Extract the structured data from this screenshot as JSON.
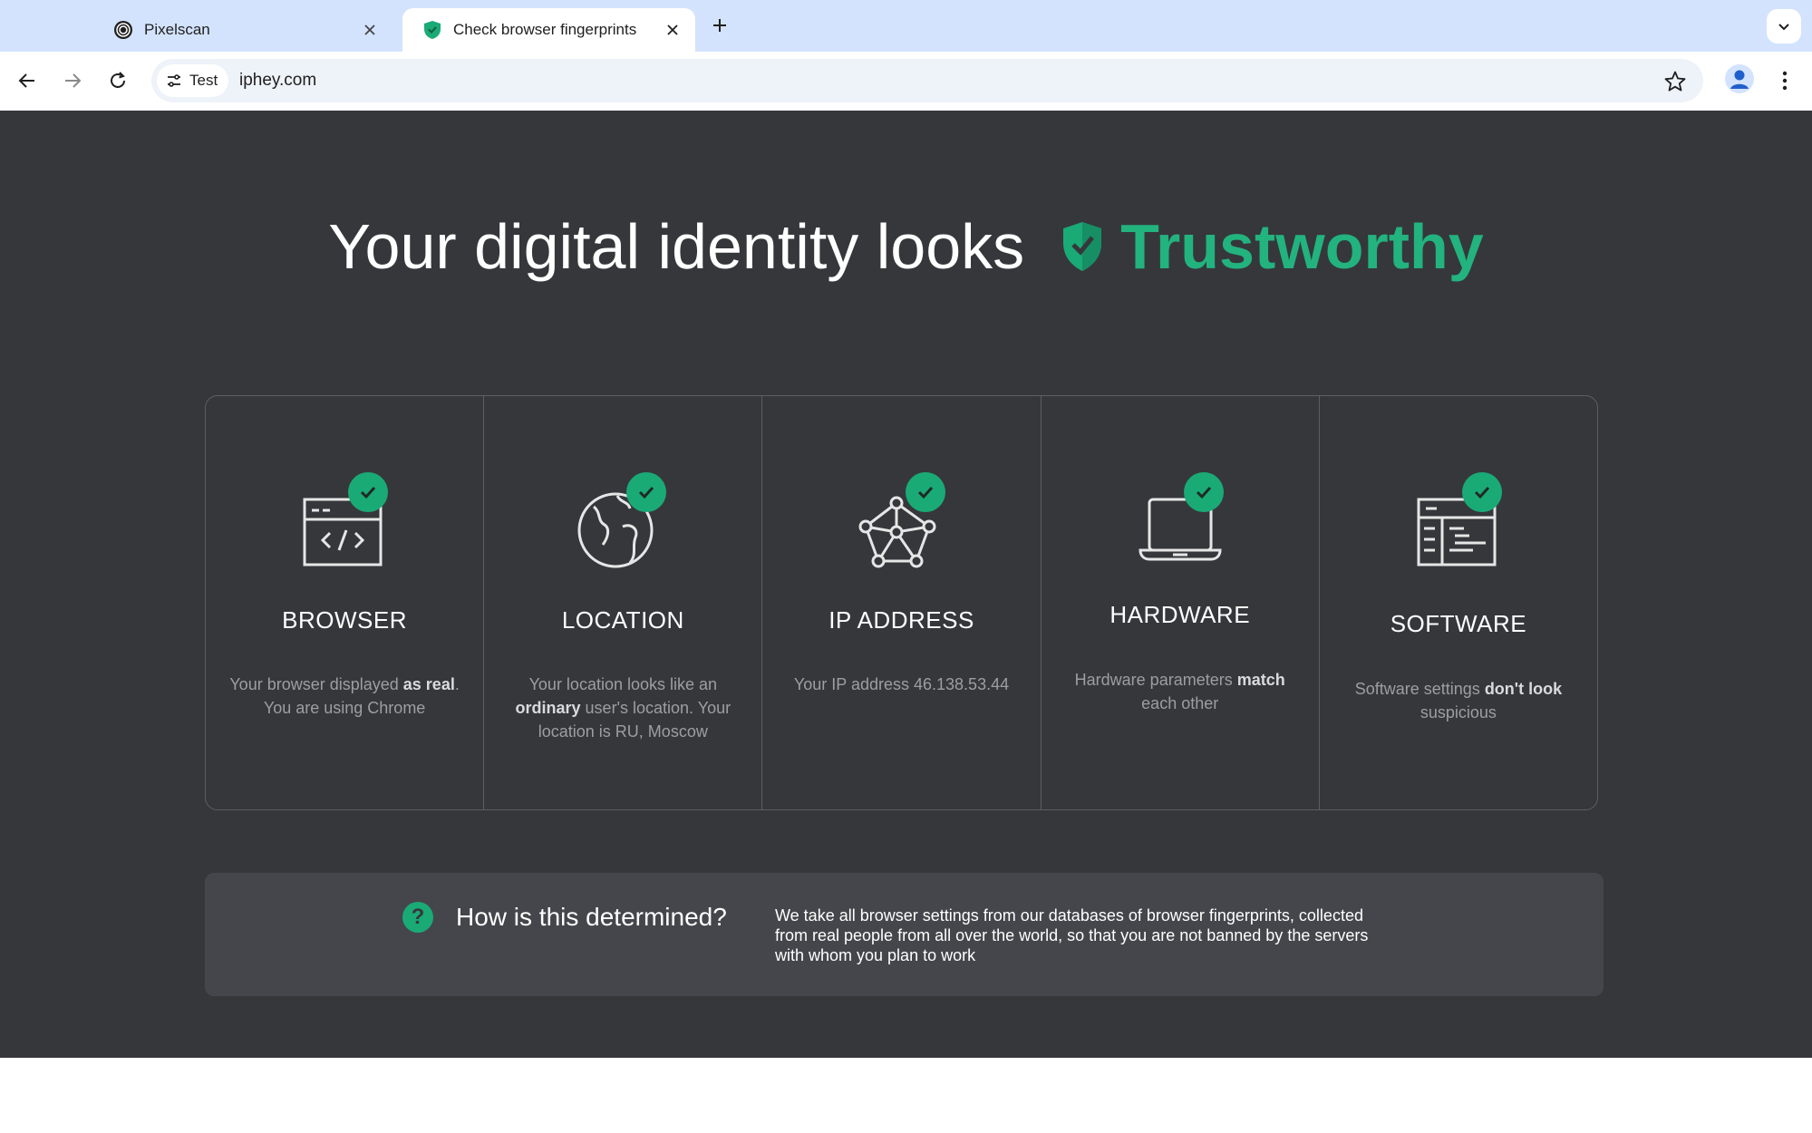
{
  "browser": {
    "tabs": [
      {
        "title": "Pixelscan",
        "active": false
      },
      {
        "title": "Check browser fingerprints",
        "active": true
      }
    ],
    "site_chip_label": "Test",
    "url": "iphey.com"
  },
  "page": {
    "headline": {
      "prefix": "Your digital identity looks",
      "status": "Trustworthy",
      "status_color": "#22b37f"
    },
    "cards": [
      {
        "label": "BROWSER",
        "icon": "browser-code-icon",
        "desc_parts": [
          [
            "Your browser displayed ",
            false
          ],
          [
            "as real",
            true
          ],
          [
            ". You are using Chrome",
            false
          ]
        ]
      },
      {
        "label": "LOCATION",
        "icon": "globe-icon",
        "desc_parts": [
          [
            "Your location looks like an ",
            false
          ],
          [
            "ordinary",
            true
          ],
          [
            " user's location. Your location is RU, Moscow",
            false
          ]
        ]
      },
      {
        "label": "IP ADDRESS",
        "icon": "network-icon",
        "desc_parts": [
          [
            "Your IP address 46.138.53.44",
            false
          ]
        ]
      },
      {
        "label": "HARDWARE",
        "icon": "laptop-icon",
        "desc_parts": [
          [
            "Hardware parameters ",
            false
          ],
          [
            "match",
            true
          ],
          [
            " each other",
            false
          ]
        ]
      },
      {
        "label": "SOFTWARE",
        "icon": "software-window-icon",
        "desc_parts": [
          [
            "Software settings ",
            false
          ],
          [
            "don't look",
            true
          ],
          [
            " suspicious",
            false
          ]
        ]
      }
    ],
    "how": {
      "title": "How is this determined?",
      "text": "We take all browser settings from our databases of browser fingerprints, collected from real people from all over the world, so that you are not banned by the servers with whom you plan to work"
    }
  }
}
